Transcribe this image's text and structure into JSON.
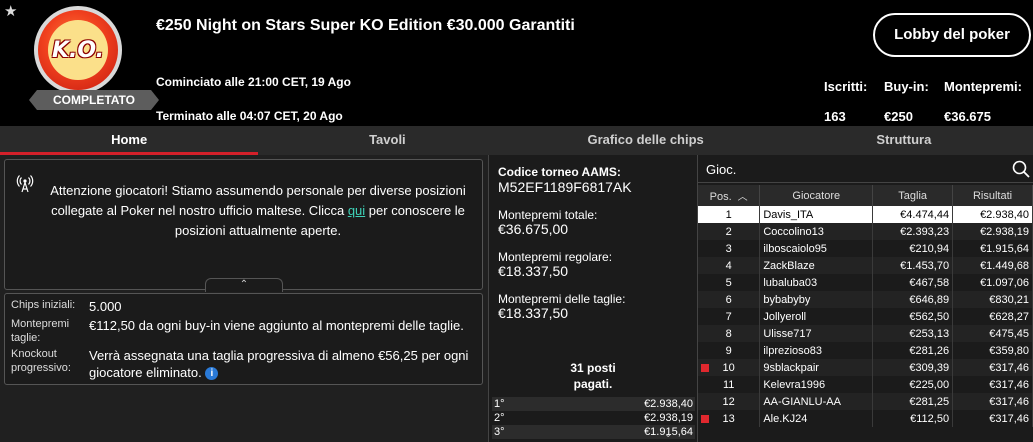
{
  "header": {
    "title": "€250 Night on Stars Super KO Edition €30.000 Garantiti",
    "logo_text": "K.O.",
    "status_badge": "COMPLETATO",
    "started": "Cominciato alle 21:00 CET, 19 Ago",
    "ended": "Terminato alle 04:07 CET, 20 Ago",
    "lobby_button": "Lobby del poker",
    "stats": {
      "entrants_label": "Iscritti:",
      "entrants_value": "163",
      "buyin_label": "Buy-in:",
      "buyin_value": "€250",
      "prize_label": "Montepremi:",
      "prize_value": "€36.675"
    }
  },
  "tabs": [
    {
      "label": "Home",
      "active": true
    },
    {
      "label": "Tavoli",
      "active": false
    },
    {
      "label": "Grafico delle chips",
      "active": false
    },
    {
      "label": "Struttura",
      "active": false
    }
  ],
  "notice": {
    "text_before": "Attenzione giocatori! Stiamo assumendo personale per diverse posizioni collegate al Poker nel nostro ufficio maltese. Clicca ",
    "link": "qui",
    "text_after": " per conoscere le posizioni attualmente aperte."
  },
  "info": {
    "chips_label": "Chips iniziali:",
    "chips_value": "5.000",
    "prize_taglie_label": "Montepremi taglie:",
    "prize_taglie_value": "€112,50 da ogni buy-in viene aggiunto al montepremi delle taglie.",
    "knockout_label": "Knockout progressivo:",
    "knockout_value": "Verrà assegnata una taglia progressiva di almeno €56,25 per ogni giocatore eliminato.",
    "info_icon": "i"
  },
  "middle": {
    "code_label": "Codice torneo AAMS:",
    "code_value": "M52EF1189F6817AK",
    "total_label": "Montepremi totale:",
    "total_value": "€36.675,00",
    "regular_label": "Montepremi regolare:",
    "regular_value": "€18.337,50",
    "bounty_label": "Montepremi delle taglie:",
    "bounty_value": "€18.337,50",
    "paid_line1": "31 posti",
    "paid_line2": "pagati.",
    "payouts": [
      {
        "pos": "1°",
        "amount": "€2.938,40"
      },
      {
        "pos": "2°",
        "amount": "€2.938,19"
      },
      {
        "pos": "3°",
        "amount": "€1.915,64"
      }
    ]
  },
  "players": {
    "search_placeholder": "Gioc.",
    "columns": {
      "pos": "Pos.",
      "player": "Giocatore",
      "bounty": "Taglia",
      "result": "Risultati"
    },
    "rows": [
      {
        "pos": "1",
        "name": "Davis_ITA",
        "bounty": "€4.474,44",
        "result": "€2.938,40",
        "flag": false
      },
      {
        "pos": "2",
        "name": "Coccolino13",
        "bounty": "€2.393,23",
        "result": "€2.938,19",
        "flag": false
      },
      {
        "pos": "3",
        "name": "ilboscaiolo95",
        "bounty": "€210,94",
        "result": "€1.915,64",
        "flag": false
      },
      {
        "pos": "4",
        "name": "ZackBlaze",
        "bounty": "€1.453,70",
        "result": "€1.449,68",
        "flag": false
      },
      {
        "pos": "5",
        "name": "lubaluba03",
        "bounty": "€467,58",
        "result": "€1.097,06",
        "flag": false
      },
      {
        "pos": "6",
        "name": "bybabyby",
        "bounty": "€646,89",
        "result": "€830,21",
        "flag": false
      },
      {
        "pos": "7",
        "name": "Jollyeroll",
        "bounty": "€562,50",
        "result": "€628,27",
        "flag": false
      },
      {
        "pos": "8",
        "name": "Ulisse717",
        "bounty": "€253,13",
        "result": "€475,45",
        "flag": false
      },
      {
        "pos": "9",
        "name": "ilprezioso83",
        "bounty": "€281,26",
        "result": "€359,80",
        "flag": false
      },
      {
        "pos": "10",
        "name": "9sblackpair",
        "bounty": "€309,39",
        "result": "€317,46",
        "flag": true
      },
      {
        "pos": "11",
        "name": "Kelevra1996",
        "bounty": "€225,00",
        "result": "€317,46",
        "flag": false
      },
      {
        "pos": "12",
        "name": "AA-GIANLU-AA",
        "bounty": "€281,25",
        "result": "€317,46",
        "flag": false
      },
      {
        "pos": "13",
        "name": "Ale.KJ24",
        "bounty": "€112,50",
        "result": "€317,46",
        "flag": true
      }
    ]
  },
  "colors": {
    "accent": "#d4202a",
    "link": "#3fd2b8",
    "flag": "#e0282e"
  }
}
